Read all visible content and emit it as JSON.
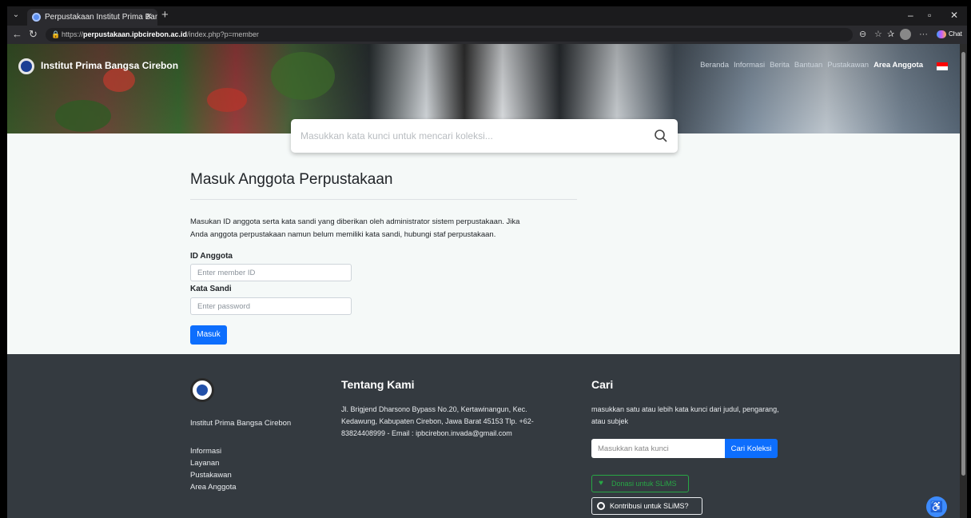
{
  "browser": {
    "tab_title": "Perpustakaan Institut Prima Bangsa",
    "url_prefix": "https://",
    "url_host": "perpustakaan.ipbcirebon.ac.id",
    "url_path": "/index.php?p=member",
    "chat_label": "Chat"
  },
  "header": {
    "brand": "Institut Prima Bangsa Cirebon",
    "nav": [
      "Beranda",
      "Informasi",
      "Berita",
      "Bantuan",
      "Pustakawan",
      "Area Anggota"
    ],
    "search_placeholder": "Masukkan kata kunci untuk mencari koleksi..."
  },
  "login": {
    "title": "Masuk Anggota Perpustakaan",
    "description": "Masukan ID anggota serta kata sandi yang diberikan oleh administrator sistem perpustakaan. Jika Anda anggota perpustakaan namun belum memiliki kata sandi, hubungi staf perpustakaan.",
    "id_label": "ID Anggota",
    "id_placeholder": "Enter member ID",
    "password_label": "Kata Sandi",
    "password_placeholder": "Enter password",
    "submit_label": "Masuk"
  },
  "footer": {
    "institution": "Institut Prima Bangsa Cirebon",
    "links": [
      "Informasi",
      "Layanan",
      "Pustakawan",
      "Area Anggota"
    ],
    "about_title": "Tentang Kami",
    "about_text": "Jl. Brigjend Dharsono Bypass No.20, Kertawinangun, Kec. Kedawung, Kabupaten Cirebon, Jawa Barat 45153 Tlp. +62-83824408999 - Email : ipbcirebon.invada@gmail.com",
    "search_title": "Cari",
    "search_text": "masukkan satu atau lebih kata kunci dari judul, pengarang, atau subjek",
    "search_placeholder": "Masukkan kata kunci",
    "search_button": "Cari Koleksi",
    "donate_label": "Donasi untuk SLiMS",
    "contribute_label": "Kontribusi untuk SLiMS?"
  },
  "colors": {
    "primary": "#0d6efd",
    "footer_bg": "#343a40",
    "success": "#28a745"
  }
}
